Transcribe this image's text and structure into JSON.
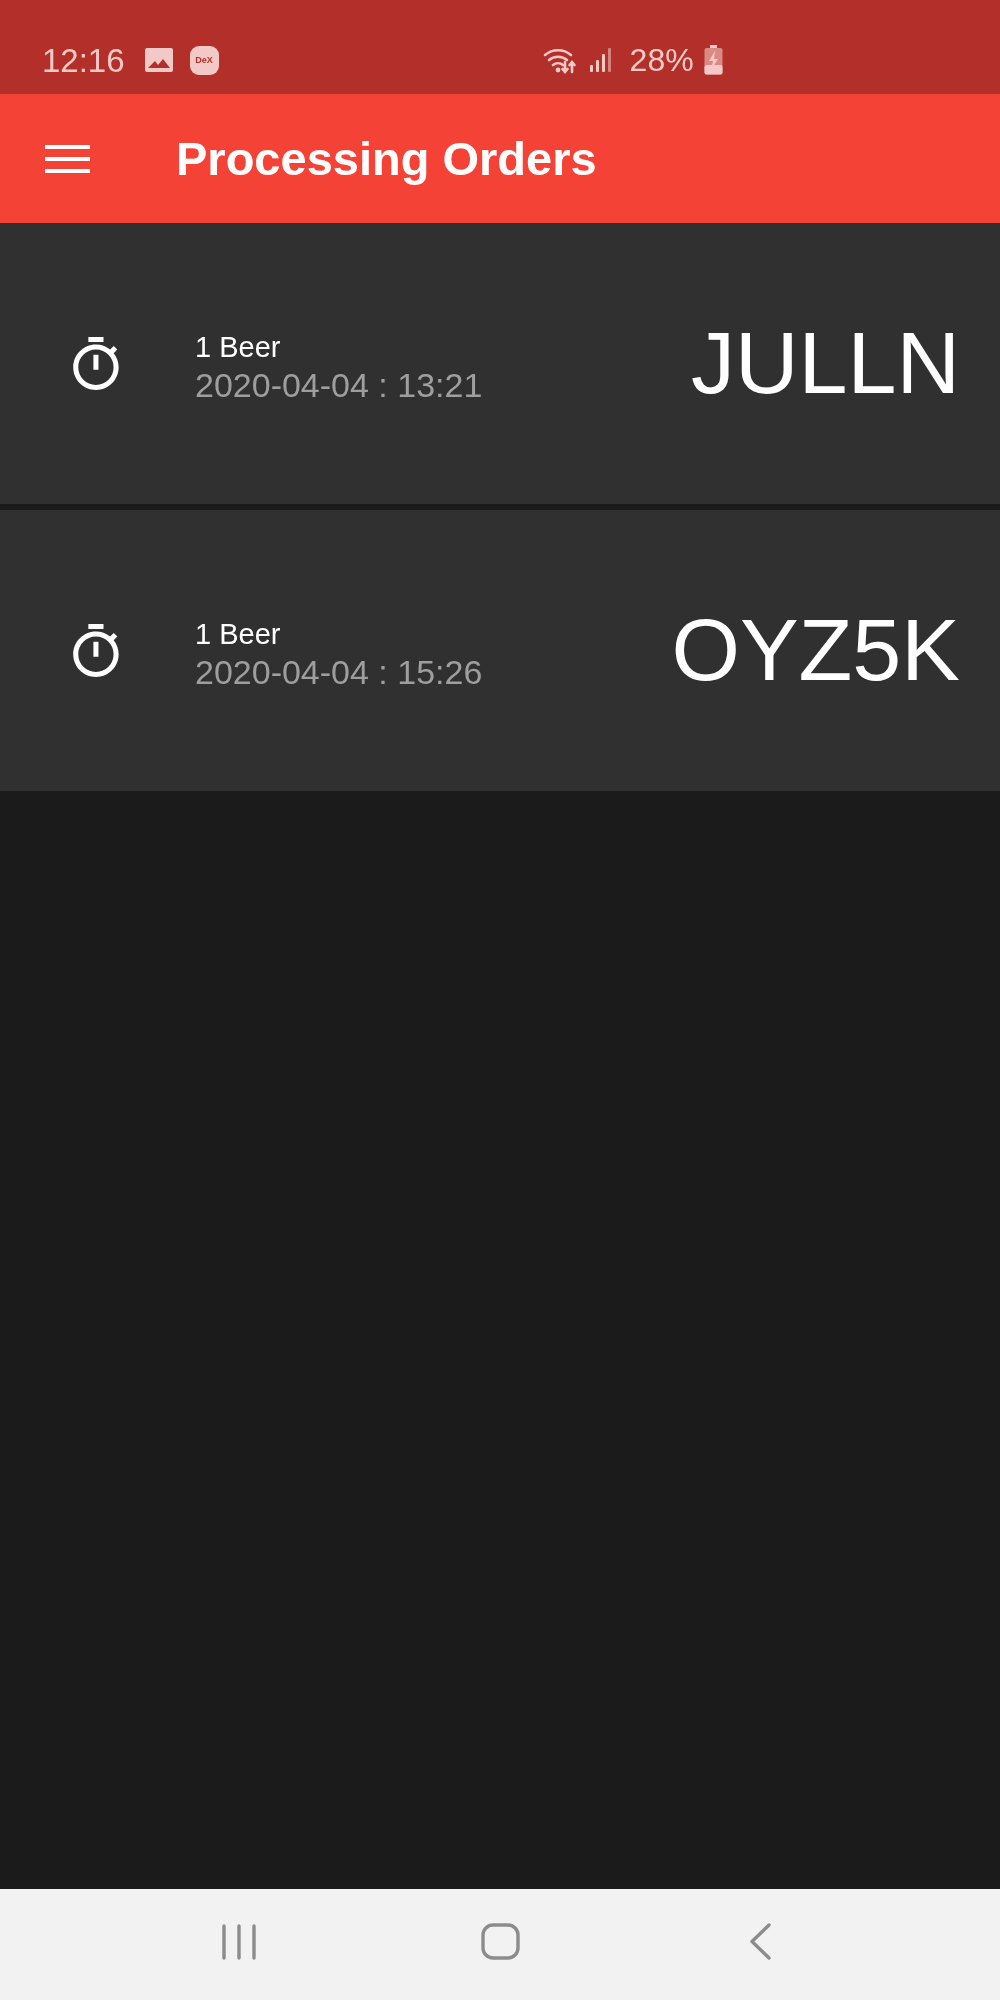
{
  "status_bar": {
    "time": "12:16",
    "notification_tag": "DeX",
    "battery": "28%"
  },
  "app_bar": {
    "title": "Processing Orders"
  },
  "orders": [
    {
      "items": "1 Beer",
      "timestamp": "2020-04-04 : 13:21",
      "code": "JULLN"
    },
    {
      "items": "1 Beer",
      "timestamp": "2020-04-04 : 15:26",
      "code": "OYZ5K"
    }
  ]
}
